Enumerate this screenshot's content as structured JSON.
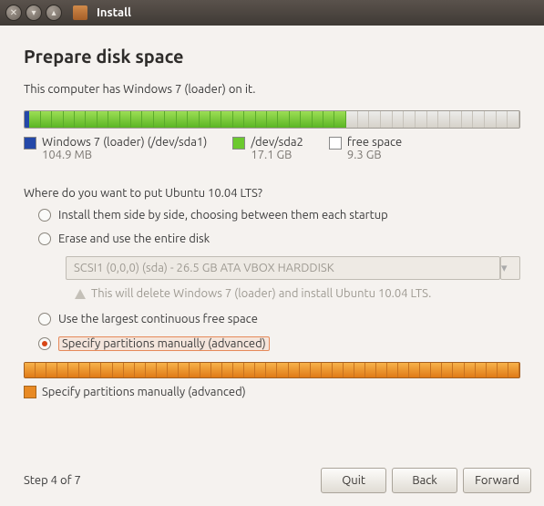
{
  "window": {
    "title": "Install"
  },
  "header": {
    "title": "Prepare disk space"
  },
  "detected_os_line": "This computer has Windows 7 (loader) on it.",
  "disk_usage": {
    "segments": [
      {
        "type": "blue",
        "pct": 1
      },
      {
        "type": "green",
        "pct": 64
      },
      {
        "type": "free",
        "pct": 35
      }
    ]
  },
  "legend": {
    "items": [
      {
        "swatch": "blue",
        "label": "Windows 7 (loader) (/dev/sda1)",
        "sub": "104.9 MB"
      },
      {
        "swatch": "green",
        "label": "/dev/sda2",
        "sub": "17.1 GB"
      },
      {
        "swatch": "free",
        "label": "free space",
        "sub": "9.3 GB"
      }
    ]
  },
  "question": "Where do you want to put Ubuntu 10.04 LTS?",
  "options": {
    "side_by_side": "Install them side by side, choosing between them each startup",
    "erase": "Erase and use the entire disk",
    "disk_dropdown": "SCSI1 (0,0,0) (sda) - 26.5 GB ATA VBOX HARDDISK",
    "erase_warning": "This will delete Windows 7 (loader) and install Ubuntu 10.04 LTS.",
    "largest_free": "Use the largest continuous free space",
    "manual": "Specify partitions manually (advanced)",
    "selected": "manual"
  },
  "bottom_summary": "Specify partitions manually (advanced)",
  "footer": {
    "step": "Step 4 of 7",
    "quit": "Quit",
    "back": "Back",
    "forward": "Forward"
  }
}
